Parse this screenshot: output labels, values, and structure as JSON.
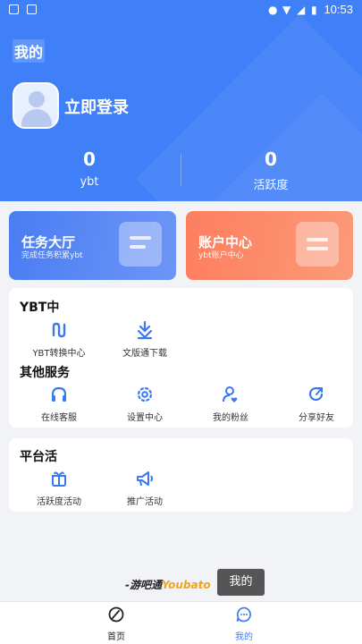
{
  "status_bar": {
    "time": "10:53"
  },
  "header": {
    "title": "我的",
    "login_text": "立即登录",
    "stats": [
      {
        "value": "0",
        "label": "ybt"
      },
      {
        "value": "0",
        "label": "活跃度"
      }
    ]
  },
  "feature_cards": [
    {
      "title": "任务大厅",
      "subtitle": "完成任务积累ybt"
    },
    {
      "title": "账户中心",
      "subtitle": "ybt账户中心"
    }
  ],
  "ybt_section": {
    "title": "YBT中",
    "items": [
      {
        "label": "YBT转换中心",
        "icon": "convert-icon"
      },
      {
        "label": "文版通下载",
        "icon": "download-icon"
      }
    ]
  },
  "services_section": {
    "title": "其他服务",
    "items": [
      {
        "label": "在线客服",
        "icon": "headset-icon"
      },
      {
        "label": "设置中心",
        "icon": "gear-icon"
      },
      {
        "label": "我的粉丝",
        "icon": "fans-icon"
      },
      {
        "label": "分享好友",
        "icon": "share-icon"
      }
    ]
  },
  "platform_section": {
    "title": "平台活",
    "items": [
      {
        "label": "活跃度活动",
        "icon": "gift-icon"
      },
      {
        "label": "推广活动",
        "icon": "megaphone-icon"
      }
    ]
  },
  "footer": {
    "brand_prefix": "-游吧通",
    "brand_accent": "Youbato",
    "toast": "我的"
  },
  "tabbar": {
    "tabs": [
      {
        "label": "首页",
        "active": false
      },
      {
        "label": "我的",
        "active": true
      }
    ]
  },
  "colors": {
    "primary": "#3f7ff8",
    "task_card": "#4a7df3",
    "account_card": "#fd7e5f",
    "icon_blue": "#3a78f2"
  }
}
